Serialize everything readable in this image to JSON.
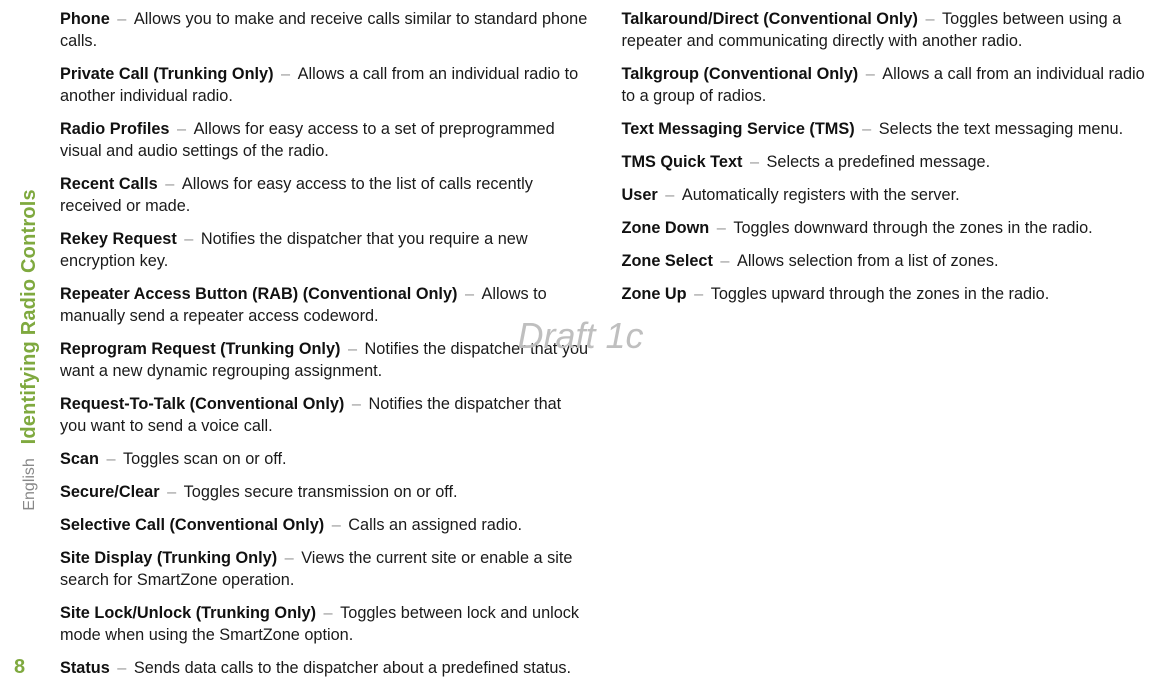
{
  "side": {
    "title": "Identifying Radio Controls",
    "language": "English",
    "page_number": "8"
  },
  "watermark": "Draft 1c",
  "entries": [
    {
      "term": "Phone",
      "desc": "Allows you to make and receive calls similar to standard phone calls."
    },
    {
      "term": "Private Call (Trunking Only)",
      "desc": "Allows a call from an individual radio to another individual radio."
    },
    {
      "term": "Radio Profiles",
      "desc": "Allows for easy access to a set of preprogrammed visual and audio settings of the radio."
    },
    {
      "term": "Recent Calls",
      "desc": "Allows for easy access to the list of calls recently received or made."
    },
    {
      "term": "Rekey Request",
      "desc": "Notifies the dispatcher that you require a new encryption key."
    },
    {
      "term": "Repeater Access Button (RAB) (Conventional Only)",
      "desc": "Allows to manually send a repeater access codeword."
    },
    {
      "term": "Reprogram Request (Trunking Only)",
      "desc": "Notifies the dispatcher that you want a new dynamic regrouping assignment."
    },
    {
      "term": "Request-To-Talk (Conventional Only)",
      "desc": "Notifies the dispatcher that you want to send a voice call."
    },
    {
      "term": "Scan",
      "desc": "Toggles scan on or off."
    },
    {
      "term": "Secure/Clear",
      "desc": "Toggles secure transmission on or off."
    },
    {
      "term": "Selective Call (Conventional Only)",
      "desc": "Calls an assigned radio."
    },
    {
      "term": "Site Display (Trunking Only)",
      "desc": "Views the current site or enable a site search for SmartZone operation."
    },
    {
      "term": "Site Lock/Unlock (Trunking Only)",
      "desc": "Toggles between lock and unlock mode when using the SmartZone option."
    },
    {
      "term": "Status",
      "desc": "Sends data calls to the dispatcher about a predefined status."
    },
    {
      "term": "Talkaround/Direct (Conventional Only)",
      "desc": "Toggles between using a repeater and communicating directly with another radio."
    },
    {
      "term": "Talkgroup (Conventional Only)",
      "desc": "Allows a call from an individual radio to a group of radios."
    },
    {
      "term": "Text Messaging Service (TMS)",
      "desc": "Selects the text messaging menu."
    },
    {
      "term": "TMS Quick Text",
      "desc": "Selects a predefined message."
    },
    {
      "term": "User",
      "desc": "Automatically registers with the server."
    },
    {
      "term": "Zone Down",
      "desc": "Toggles downward through the zones in the radio."
    },
    {
      "term": "Zone Select",
      "desc": "Allows selection from a list of zones."
    },
    {
      "term": "Zone Up",
      "desc": "Toggles upward through the zones in the radio."
    }
  ]
}
